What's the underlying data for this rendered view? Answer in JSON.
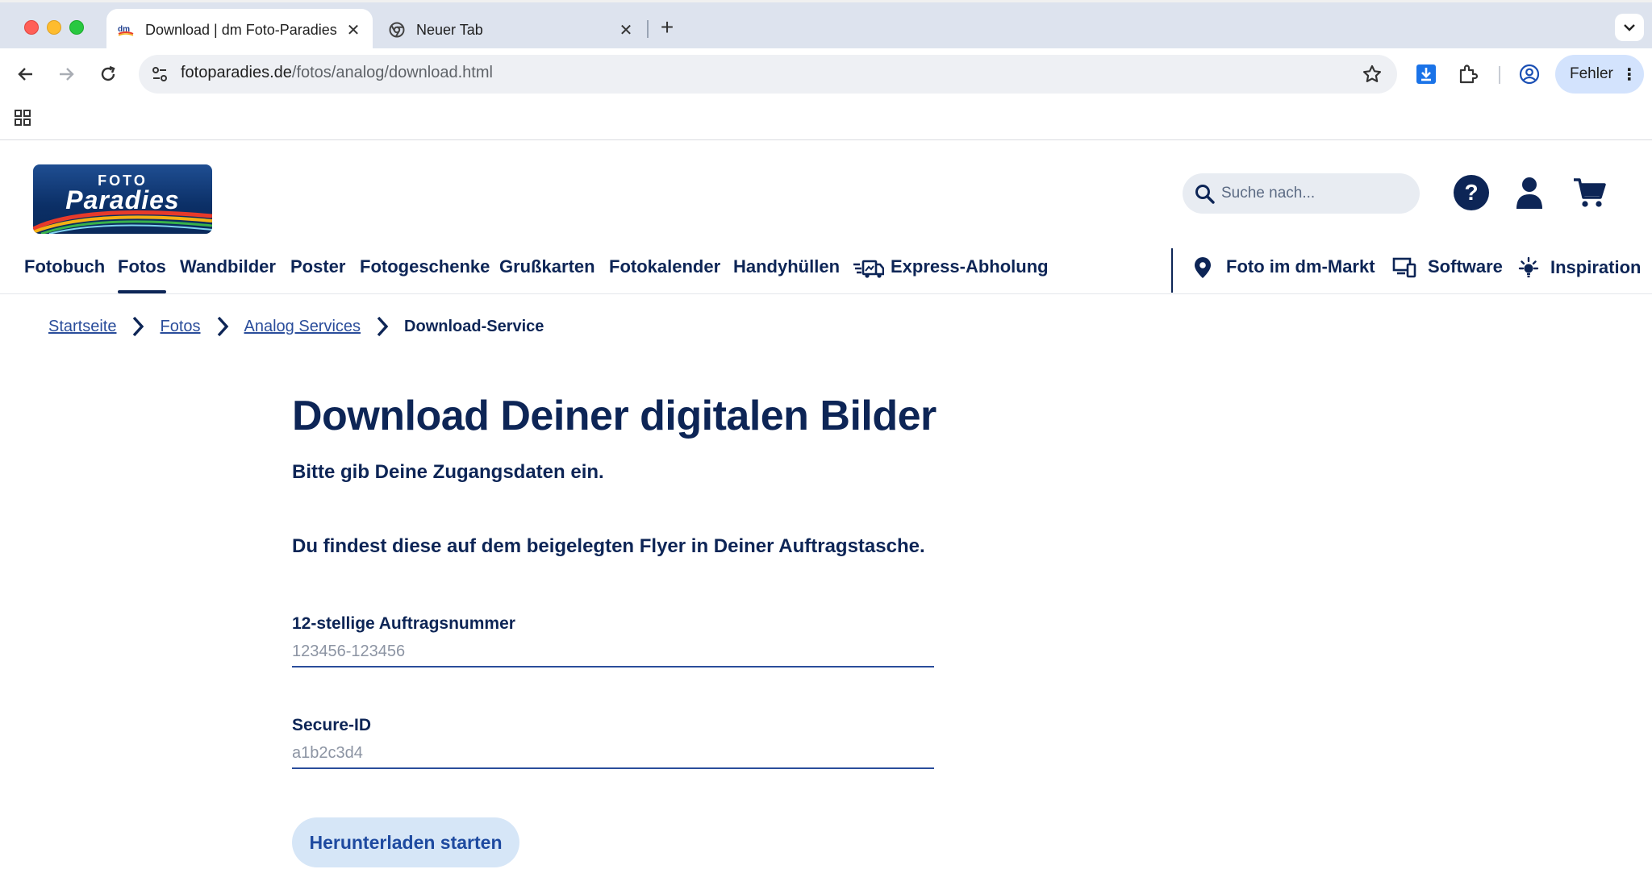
{
  "browser": {
    "tabs": [
      {
        "title": "Download | dm Foto-Paradies",
        "active": true
      },
      {
        "title": "Neuer Tab",
        "active": false
      }
    ],
    "url_host": "fotoparadies.de",
    "url_path": "/fotos/analog/download.html",
    "profile_label": "Fehler"
  },
  "site": {
    "logo_top": "FOTO",
    "logo_main": "Paradies",
    "search_placeholder": "Suche nach...",
    "help_symbol": "?",
    "nav": [
      {
        "label": "Fotobuch"
      },
      {
        "label": "Fotos",
        "active": true
      },
      {
        "label": "Wandbilder"
      },
      {
        "label": "Poster"
      },
      {
        "label": "Fotogeschenke"
      },
      {
        "label": "Grußkarten"
      },
      {
        "label": "Fotokalender"
      },
      {
        "label": "Handyhüllen"
      },
      {
        "label": "Express-Abholung"
      }
    ],
    "nav_right": [
      {
        "label": "Foto im dm-Markt"
      },
      {
        "label": "Software"
      },
      {
        "label": "Inspiration"
      }
    ],
    "breadcrumb": [
      "Startseite",
      "Fotos",
      "Analog Services",
      "Download-Service"
    ]
  },
  "content": {
    "title": "Download Deiner digitalen Bilder",
    "lead": "Bitte gib Deine Zugangsdaten ein.",
    "lead2": "Du findest diese auf dem beigelegten Flyer in Deiner Auftragstasche.",
    "order_label": "12-stellige Auftragsnummer",
    "order_placeholder": "123456-123456",
    "secure_label": "Secure-ID",
    "secure_placeholder": "a1b2c3d4",
    "submit_label": "Herunterladen starten"
  },
  "colors": {
    "brand_navy": "#0d2556",
    "link_blue": "#2a4d9b",
    "button_bg": "#d6e6f7"
  }
}
